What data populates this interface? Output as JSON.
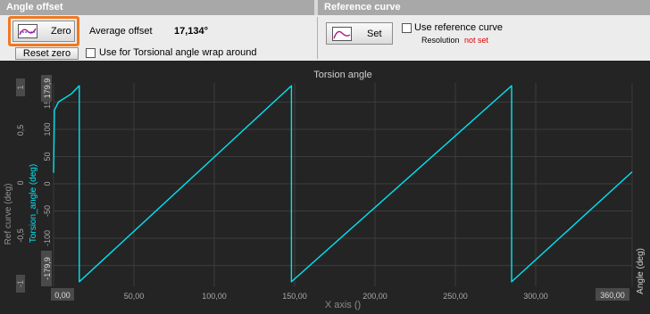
{
  "angle_offset": {
    "header": "Angle offset",
    "zero_label": "Zero",
    "average_offset_label": "Average offset",
    "average_offset_value": "17,134°",
    "reset_zero_label": "Reset zero",
    "wrap_checkbox_label": "Use for Torsional angle wrap around",
    "wrap_checked": false
  },
  "reference_curve": {
    "header": "Reference curve",
    "set_label": "Set",
    "use_checkbox_label": "Use reference curve",
    "use_checked": false,
    "resolution_label": "Resolution",
    "resolution_value": "not set"
  },
  "colors": {
    "trace": "#00e5f5",
    "highlight": "#f07820",
    "not_set": "#e00000",
    "plot_bg": "#242424"
  },
  "chart_data": {
    "type": "line",
    "title": "Torsion angle",
    "xlabel": "X axis ()",
    "left_axis_label": "Ref curve (deg)",
    "left_axis_ticks": [
      "1",
      "0,5",
      "0",
      "-0,5",
      "-1"
    ],
    "ylabel": "Torsion_angle (deg)",
    "ylim": [
      -190,
      190
    ],
    "y_ticks": [
      150,
      100,
      50,
      0,
      -50,
      -100,
      -150
    ],
    "y_tick_labels": [
      "150",
      "100",
      "50",
      "0",
      "-50",
      "-100",
      "-150"
    ],
    "y_bound_labels": [
      "179,9",
      "-179,9"
    ],
    "right_axis_label": "Angle (deg)",
    "xlim": [
      0,
      360
    ],
    "x_ticks": [
      50,
      100,
      150,
      200,
      250,
      300
    ],
    "x_tick_labels": [
      "50,00",
      "100,00",
      "150,00",
      "200,00",
      "250,00",
      "300,00"
    ],
    "x_bound_labels": [
      "0,00",
      "360,00"
    ],
    "grid": true,
    "series": [
      {
        "values": [
          {
            "x": 0,
            "y": 20
          },
          {
            "x": 0.5,
            "y": 135
          },
          {
            "x": 3,
            "y": 150
          },
          {
            "x": 11,
            "y": 165
          },
          {
            "x": 16,
            "y": 180
          },
          {
            "x": 16,
            "y": -180
          },
          {
            "x": 148,
            "y": 180
          },
          {
            "x": 148,
            "y": -180
          },
          {
            "x": 285,
            "y": 180
          },
          {
            "x": 285,
            "y": -180
          },
          {
            "x": 360,
            "y": 22
          }
        ]
      }
    ]
  }
}
